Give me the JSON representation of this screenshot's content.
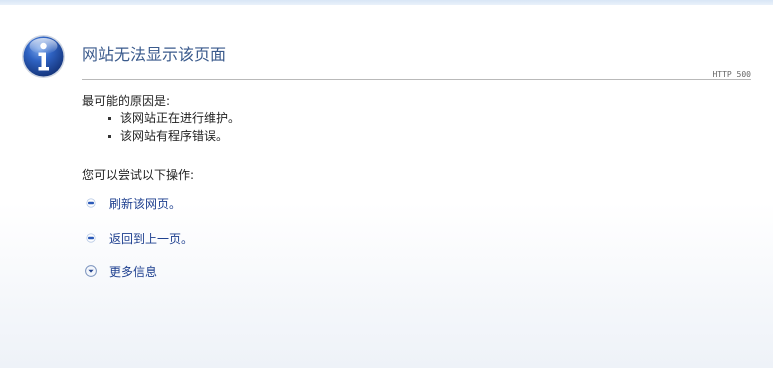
{
  "page": {
    "title": "网站无法显示该页面",
    "http_code": "HTTP 500",
    "reasons_heading": "最可能的原因是:",
    "reasons": [
      "该网站正在进行维护。",
      "该网站有程序错误。"
    ],
    "try_heading": "您可以尝试以下操作:",
    "actions": {
      "refresh": "刷新该网页。",
      "back": "返回到上一页。",
      "more_info": "更多信息"
    }
  },
  "icons": {
    "header_icon": "info-icon",
    "action_bullet": "blue-bullet-icon",
    "expand_icon": "chevron-down-circle-icon"
  },
  "colors": {
    "title": "#3a5a8c",
    "link": "#1d3f8f",
    "icon_blue": "#2a59b8"
  }
}
